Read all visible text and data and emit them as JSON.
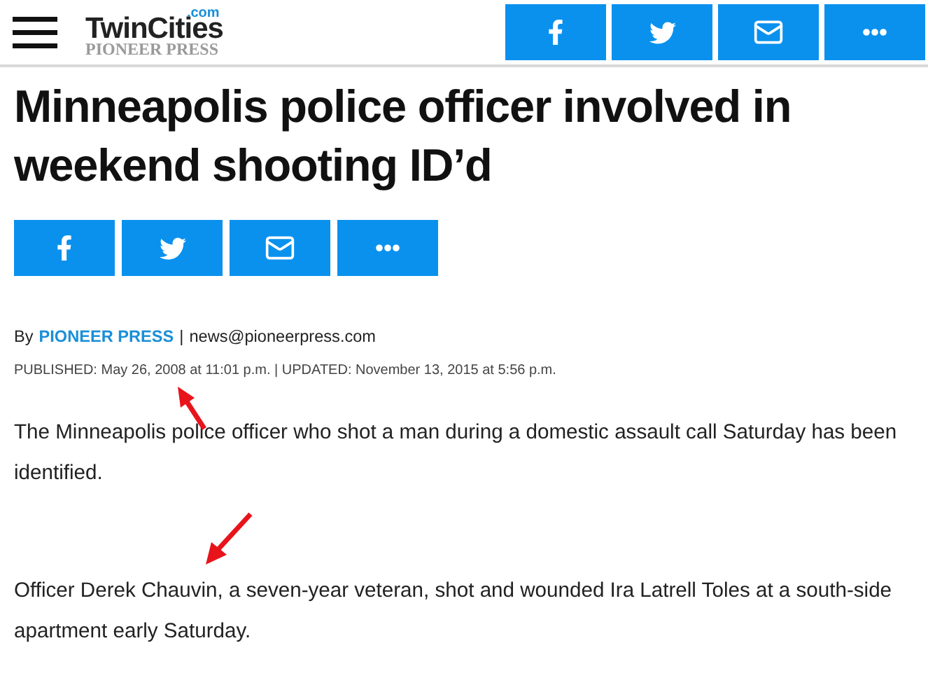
{
  "header": {
    "logo": {
      "name": "TwinCities",
      "suffix": ".com",
      "sub": "PIONEER PRESS"
    },
    "share_buttons": [
      {
        "kind": "facebook"
      },
      {
        "kind": "twitter"
      },
      {
        "kind": "email"
      },
      {
        "kind": "more"
      }
    ]
  },
  "article": {
    "headline": "Minneapolis police officer involved in weekend shooting ID’d",
    "share_buttons": [
      {
        "kind": "facebook"
      },
      {
        "kind": "twitter"
      },
      {
        "kind": "email"
      },
      {
        "kind": "more"
      }
    ],
    "byline": {
      "prefix": "By",
      "author": "PIONEER PRESS",
      "separator": "|",
      "email": "news@pioneerpress.com"
    },
    "dateline": "PUBLISHED: May 26, 2008 at 11:01 p.m. | UPDATED: November 13, 2015 at 5:56 p.m.",
    "paragraphs": [
      "The Minneapolis police officer who shot a man during a domestic assault call Saturday has been identified.",
      "Officer Derek Chauvin, a seven-year veteran, shot and wounded Ira Latrell Toles at a south-side apartment early Saturday."
    ]
  }
}
